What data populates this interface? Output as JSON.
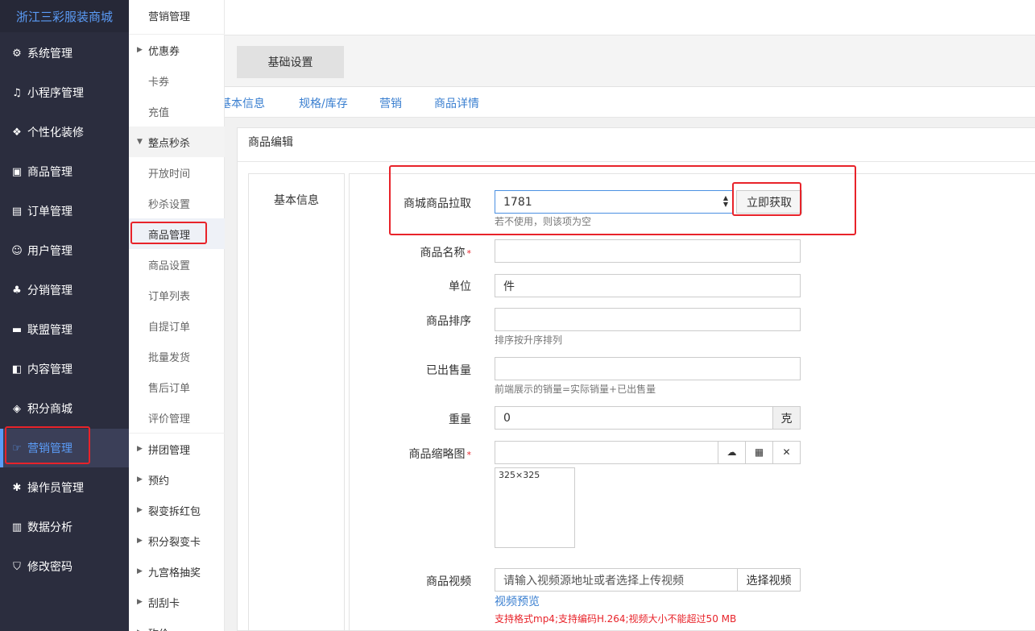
{
  "brand": "浙江三彩服装商城",
  "sidebar": {
    "items": [
      {
        "icon": "gear-icon",
        "label": "系统管理"
      },
      {
        "icon": "miniprogram-icon",
        "label": "小程序管理"
      },
      {
        "icon": "decoration-icon",
        "label": "个性化装修"
      },
      {
        "icon": "bag-icon",
        "label": "商品管理"
      },
      {
        "icon": "order-list-icon",
        "label": "订单管理"
      },
      {
        "icon": "user-icon",
        "label": "用户管理"
      },
      {
        "icon": "network-icon",
        "label": "分销管理"
      },
      {
        "icon": "store-icon",
        "label": "联盟管理"
      },
      {
        "icon": "content-icon",
        "label": "内容管理"
      },
      {
        "icon": "cube-icon",
        "label": "积分商城"
      },
      {
        "icon": "marketing-icon",
        "label": "营销管理"
      },
      {
        "icon": "cog-icon",
        "label": "操作员管理"
      },
      {
        "icon": "chart-icon",
        "label": "数据分析"
      },
      {
        "icon": "shield-icon",
        "label": "修改密码"
      }
    ]
  },
  "submenu": {
    "title": "营销管理",
    "coupon": "优惠券",
    "card": "卡券",
    "recharge": "充值",
    "flash_sale": "整点秒杀",
    "flash_children": [
      "开放时间",
      "秒杀设置",
      "商品管理",
      "商品设置",
      "订单列表",
      "自提订单",
      "批量发货",
      "售后订单",
      "评价管理"
    ],
    "more": [
      "拼团管理",
      "预约",
      "裂变拆红包",
      "积分裂变卡",
      "九宫格抽奖",
      "刮刮卡",
      "砍价"
    ]
  },
  "tabs": {
    "main": "基础设置"
  },
  "subtabs": [
    "基本信息",
    "规格/库存",
    "营销",
    "商品详情"
  ],
  "panel": {
    "title": "商品编辑",
    "section": "基本信息"
  },
  "form": {
    "pull_label": "商城商品拉取",
    "pull_value": "1781",
    "pull_button": "立即获取",
    "pull_help": "若不使用，则该项为空",
    "name_label": "商品名称",
    "name_value": "",
    "unit_label": "单位",
    "unit_value": "件",
    "sort_label": "商品排序",
    "sort_value": "",
    "sort_help": "排序按升序排列",
    "sold_label": "已出售量",
    "sold_value": "",
    "sold_help": "前端展示的销量=实际销量+已出售量",
    "weight_label": "重量",
    "weight_value": "0",
    "weight_unit": "克",
    "thumb_label": "商品缩略图",
    "thumb_size": "325×325",
    "video_label": "商品视频",
    "video_placeholder": "请输入视频源地址或者选择上传视频",
    "video_button": "选择视频",
    "video_preview": "视频预览",
    "video_help": "支持格式mp4;支持编码H.264;视频大小不能超过50 MB",
    "required_mark": "*"
  },
  "colors": {
    "sidebar": "#2b2d3e",
    "accent": "#5b9cf7",
    "highlight": "#e8232a",
    "link": "#3a7fd0"
  }
}
